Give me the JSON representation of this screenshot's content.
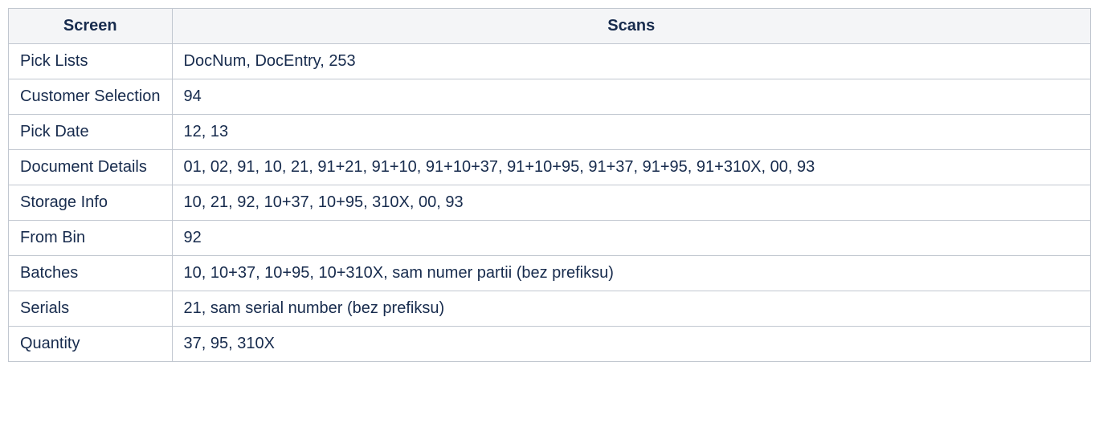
{
  "table": {
    "headers": {
      "col1": "Screen",
      "col2": "Scans"
    },
    "rows": [
      {
        "screen": "Pick Lists",
        "scans": "DocNum, DocEntry, 253"
      },
      {
        "screen": "Customer Selection",
        "scans": "94"
      },
      {
        "screen": "Pick Date",
        "scans": "12, 13"
      },
      {
        "screen": "Document Details",
        "scans": "01, 02, 91, 10, 21, 91+21, 91+10, 91+10+37, 91+10+95, 91+37, 91+95, 91+310X, 00, 93"
      },
      {
        "screen": "Storage Info",
        "scans": "10, 21, 92, 10+37, 10+95, 310X, 00, 93"
      },
      {
        "screen": "From Bin",
        "scans": "92"
      },
      {
        "screen": "Batches",
        "scans": "10, 10+37, 10+95, 10+310X, sam numer partii (bez prefiksu)"
      },
      {
        "screen": "Serials",
        "scans": "21, sam serial number (bez prefiksu)"
      },
      {
        "screen": "Quantity",
        "scans": "37, 95, 310X"
      }
    ]
  }
}
